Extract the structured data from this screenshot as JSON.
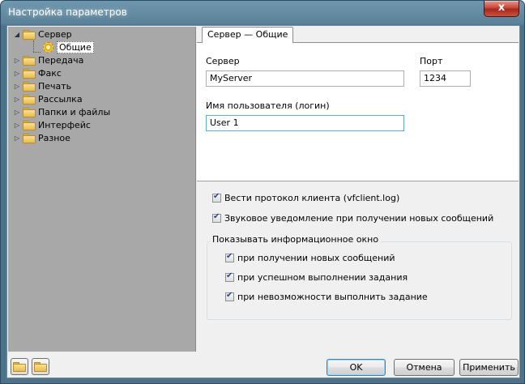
{
  "window": {
    "title": "Настройка параметров",
    "close_label": "x"
  },
  "tree": {
    "items": [
      {
        "label": "Сервер",
        "expanded": true,
        "children": [
          {
            "label": "Общие",
            "selected": true
          }
        ]
      },
      {
        "label": "Передача"
      },
      {
        "label": "Факс"
      },
      {
        "label": "Печать"
      },
      {
        "label": "Рассылка"
      },
      {
        "label": "Папки и файлы"
      },
      {
        "label": "Интерфейс"
      },
      {
        "label": "Разное"
      }
    ]
  },
  "tab": {
    "label": "Сервер — Общие"
  },
  "form": {
    "server_label": "Сервер",
    "server_value": "MyServer",
    "port_label": "Порт",
    "port_value": "1234",
    "username_label": "Имя пользователя (логин)",
    "username_value": "User 1"
  },
  "options": {
    "log_label": "Вести протокол клиента (vfclient.log)",
    "log_checked": true,
    "sound_label": "Звуковое уведомление при получении новых сообщений",
    "sound_checked": true
  },
  "info_group": {
    "title": "Показывать информационное окно",
    "items": [
      {
        "label": "при получении новых сообщений",
        "checked": true
      },
      {
        "label": "при успешном выполнении задания",
        "checked": true
      },
      {
        "label": "при невозможности выполнить задание",
        "checked": true
      }
    ]
  },
  "buttons": {
    "ok": "OK",
    "cancel": "Отмена",
    "apply": "Применить"
  },
  "colors": {
    "titlebar": "#5a8198",
    "tree_bg": "#a8a8a8",
    "close": "#c7473a"
  }
}
